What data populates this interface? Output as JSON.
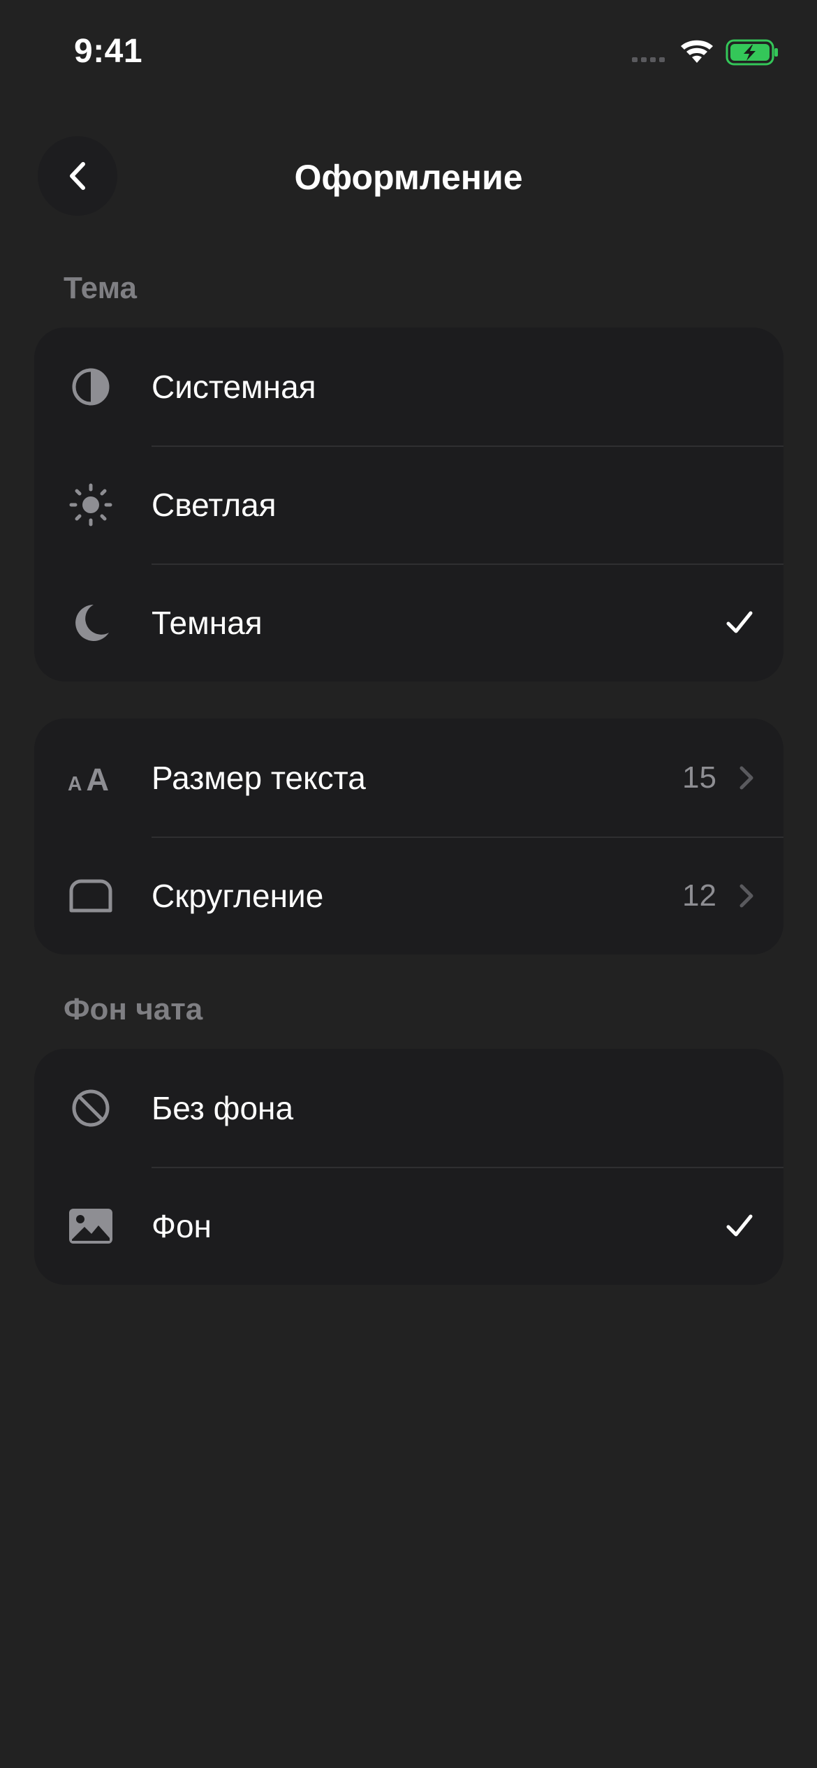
{
  "status_bar": {
    "time": "9:41"
  },
  "nav": {
    "title": "Оформление",
    "back_icon": "chevron-left-icon"
  },
  "theme_section": {
    "label": "Тема",
    "items": [
      {
        "label": "Системная",
        "icon": "half-circle-icon",
        "selected": false
      },
      {
        "label": "Светлая",
        "icon": "sun-icon",
        "selected": false
      },
      {
        "label": "Темная",
        "icon": "moon-icon",
        "selected": true
      }
    ]
  },
  "appearance_section": {
    "items": [
      {
        "label": "Размер текста",
        "icon": "text-size-icon",
        "value": "15"
      },
      {
        "label": "Скругление",
        "icon": "rounded-corner-icon",
        "value": "12"
      }
    ]
  },
  "chat_bg_section": {
    "label": "Фон чата",
    "items": [
      {
        "label": "Без фона",
        "icon": "no-entry-icon",
        "selected": false
      },
      {
        "label": "Фон",
        "icon": "image-icon",
        "selected": true
      }
    ]
  },
  "colors": {
    "background": "#222222",
    "card": "#1c1c1e",
    "secondary_text": "#8e8e93",
    "icon_gray": "#8e8e93",
    "battery_green": "#34c759"
  }
}
